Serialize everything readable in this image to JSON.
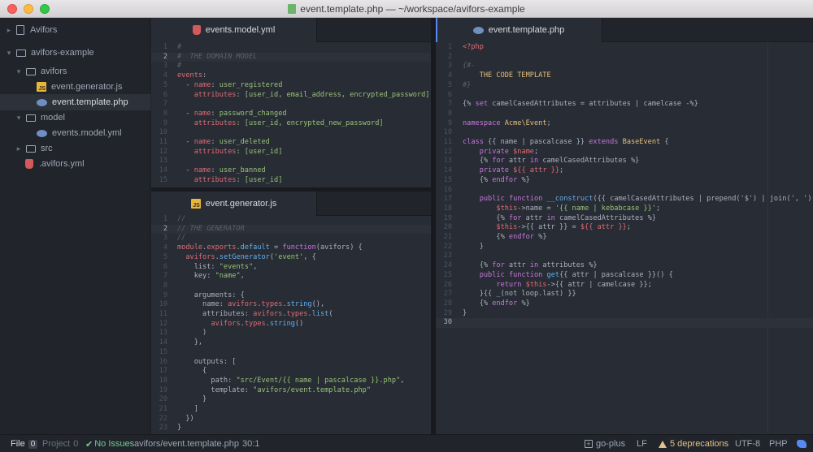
{
  "window": {
    "title": "event.template.php — ~/workspace/avifors-example"
  },
  "tree": {
    "root_project": "Avifors",
    "items": [
      {
        "label": "avifors-example",
        "icon": "folder-icon"
      },
      {
        "label": "avifors",
        "icon": "folder-icon"
      },
      {
        "label": "event.generator.js",
        "icon": "js-file-icon"
      },
      {
        "label": "event.template.php",
        "icon": "php-file-icon"
      },
      {
        "label": "model",
        "icon": "folder-icon"
      },
      {
        "label": "events.model.yml",
        "icon": "php-file-icon"
      },
      {
        "label": "src",
        "icon": "folder-icon"
      },
      {
        "label": ".avifors.yml",
        "icon": "yml-file-icon"
      }
    ]
  },
  "panes": {
    "yml": {
      "tab": "events.model.yml",
      "lines": [
        {
          "n": "1",
          "t": [
            [
              "#",
              "com"
            ]
          ]
        },
        {
          "n": "2",
          "t": [
            [
              "#  THE DOMAIN MODEL",
              "com"
            ]
          ],
          "cursor": true
        },
        {
          "n": "3",
          "t": [
            [
              "#",
              "com"
            ]
          ]
        },
        {
          "n": "4",
          "t": [
            [
              "events",
              "key"
            ],
            [
              ":",
              ""
            ]
          ]
        },
        {
          "n": "5",
          "t": [
            [
              "  - ",
              ""
            ],
            [
              "name",
              "key"
            ],
            [
              ": ",
              ""
            ],
            [
              "user_registered",
              "str"
            ]
          ]
        },
        {
          "n": "6",
          "t": [
            [
              "    ",
              ""
            ],
            [
              "attributes",
              "key"
            ],
            [
              ": [user_id, email_address, encrypted_password]",
              "str"
            ]
          ]
        },
        {
          "n": "7",
          "t": []
        },
        {
          "n": "8",
          "t": [
            [
              "  - ",
              ""
            ],
            [
              "name",
              "key"
            ],
            [
              ": ",
              ""
            ],
            [
              "password_changed",
              "str"
            ]
          ]
        },
        {
          "n": "9",
          "t": [
            [
              "    ",
              ""
            ],
            [
              "attributes",
              "key"
            ],
            [
              ": [user_id, encrypted_new_password]",
              "str"
            ]
          ]
        },
        {
          "n": "10",
          "t": []
        },
        {
          "n": "11",
          "t": [
            [
              "  - ",
              ""
            ],
            [
              "name",
              "key"
            ],
            [
              ": ",
              ""
            ],
            [
              "user_deleted",
              "str"
            ]
          ]
        },
        {
          "n": "12",
          "t": [
            [
              "    ",
              ""
            ],
            [
              "attributes",
              "key"
            ],
            [
              ": [user_id]",
              "str"
            ]
          ]
        },
        {
          "n": "13",
          "t": []
        },
        {
          "n": "14",
          "t": [
            [
              "  - ",
              ""
            ],
            [
              "name",
              "key"
            ],
            [
              ": ",
              ""
            ],
            [
              "user_banned",
              "str"
            ]
          ]
        },
        {
          "n": "15",
          "t": [
            [
              "    ",
              ""
            ],
            [
              "attributes",
              "key"
            ],
            [
              ": [user_id]",
              "str"
            ]
          ]
        }
      ]
    },
    "js": {
      "tab": "event.generator.js",
      "lines": [
        {
          "n": "1",
          "t": [
            [
              "//",
              "com"
            ]
          ]
        },
        {
          "n": "2",
          "t": [
            [
              "// THE GENERATOR",
              "com"
            ]
          ],
          "cursor": true
        },
        {
          "n": "3",
          "t": [
            [
              "//",
              "com"
            ]
          ]
        },
        {
          "n": "4",
          "t": [
            [
              "module",
              "key"
            ],
            [
              ".",
              ""
            ],
            [
              "exports",
              "key"
            ],
            [
              ".",
              ""
            ],
            [
              "default",
              "fn"
            ],
            [
              " = ",
              ""
            ],
            [
              "function",
              "kw"
            ],
            [
              "(avifors) {",
              ""
            ]
          ]
        },
        {
          "n": "5",
          "t": [
            [
              "  ",
              ""
            ],
            [
              "avifors",
              "key"
            ],
            [
              ".",
              ""
            ],
            [
              "setGenerator",
              "fn"
            ],
            [
              "(",
              ""
            ],
            [
              "'event'",
              "str"
            ],
            [
              ", {",
              ""
            ]
          ]
        },
        {
          "n": "6",
          "t": [
            [
              "    list: ",
              ""
            ],
            [
              "\"events\"",
              "str"
            ],
            [
              ",",
              ""
            ]
          ]
        },
        {
          "n": "7",
          "t": [
            [
              "    key: ",
              ""
            ],
            [
              "\"name\"",
              "str"
            ],
            [
              ",",
              ""
            ]
          ]
        },
        {
          "n": "8",
          "t": []
        },
        {
          "n": "9",
          "t": [
            [
              "    arguments: {",
              ""
            ]
          ]
        },
        {
          "n": "10",
          "t": [
            [
              "      name: ",
              ""
            ],
            [
              "avifors",
              "key"
            ],
            [
              ".",
              ""
            ],
            [
              "types",
              "key"
            ],
            [
              ".",
              ""
            ],
            [
              "string",
              "fn"
            ],
            [
              "(),",
              ""
            ]
          ]
        },
        {
          "n": "11",
          "t": [
            [
              "      attributes: ",
              ""
            ],
            [
              "avifors",
              "key"
            ],
            [
              ".",
              ""
            ],
            [
              "types",
              "key"
            ],
            [
              ".",
              ""
            ],
            [
              "list",
              "fn"
            ],
            [
              "(",
              ""
            ]
          ]
        },
        {
          "n": "12",
          "t": [
            [
              "        ",
              ""
            ],
            [
              "avifors",
              "key"
            ],
            [
              ".",
              ""
            ],
            [
              "types",
              "key"
            ],
            [
              ".",
              ""
            ],
            [
              "string",
              "fn"
            ],
            [
              "()",
              ""
            ]
          ]
        },
        {
          "n": "13",
          "t": [
            [
              "      )",
              ""
            ]
          ]
        },
        {
          "n": "14",
          "t": [
            [
              "    },",
              ""
            ]
          ]
        },
        {
          "n": "15",
          "t": []
        },
        {
          "n": "16",
          "t": [
            [
              "    outputs: [",
              ""
            ]
          ]
        },
        {
          "n": "17",
          "t": [
            [
              "      {",
              ""
            ]
          ]
        },
        {
          "n": "18",
          "t": [
            [
              "        path: ",
              ""
            ],
            [
              "\"src/Event/{{ name | pascalcase }}.php\"",
              "str"
            ],
            [
              ",",
              ""
            ]
          ]
        },
        {
          "n": "19",
          "t": [
            [
              "        template: ",
              ""
            ],
            [
              "\"avifors/event.template.php\"",
              "str"
            ]
          ]
        },
        {
          "n": "20",
          "t": [
            [
              "      }",
              ""
            ]
          ]
        },
        {
          "n": "21",
          "t": [
            [
              "    ]",
              ""
            ]
          ]
        },
        {
          "n": "22",
          "t": [
            [
              "  })",
              ""
            ]
          ]
        },
        {
          "n": "23",
          "t": [
            [
              "}",
              ""
            ]
          ]
        }
      ]
    },
    "php": {
      "tab": "event.template.php",
      "lines": [
        {
          "n": "1",
          "t": [
            [
              "<?php",
              "key"
            ]
          ]
        },
        {
          "n": "2",
          "t": []
        },
        {
          "n": "3",
          "t": [
            [
              "{#-",
              "com"
            ]
          ]
        },
        {
          "n": "4",
          "t": [
            [
              "    THE CODE TEMPLATE",
              "tag"
            ]
          ]
        },
        {
          "n": "5",
          "t": [
            [
              "#}",
              "com"
            ]
          ]
        },
        {
          "n": "6",
          "t": []
        },
        {
          "n": "7",
          "t": [
            [
              "{% ",
              ""
            ],
            [
              "set",
              "kw"
            ],
            [
              " camelCasedAttributes = attributes | camelcase -%}",
              ""
            ]
          ]
        },
        {
          "n": "8",
          "t": []
        },
        {
          "n": "9",
          "t": [
            [
              "namespace",
              "kw"
            ],
            [
              " ",
              ""
            ],
            [
              "Acme\\Event",
              "tag"
            ],
            [
              ";",
              ""
            ]
          ]
        },
        {
          "n": "10",
          "t": []
        },
        {
          "n": "11",
          "t": [
            [
              "class",
              "kw"
            ],
            [
              " {{ name | pascalcase }} ",
              ""
            ],
            [
              "extends",
              "kw"
            ],
            [
              " ",
              ""
            ],
            [
              "BaseEvent",
              "tag"
            ],
            [
              " {",
              ""
            ]
          ]
        },
        {
          "n": "12",
          "t": [
            [
              "    ",
              ""
            ],
            [
              "private",
              "kw"
            ],
            [
              " ",
              ""
            ],
            [
              "$name",
              "key"
            ],
            [
              ";",
              ""
            ]
          ]
        },
        {
          "n": "13",
          "t": [
            [
              "    {% ",
              ""
            ],
            [
              "for",
              "kw"
            ],
            [
              " attr ",
              ""
            ],
            [
              "in",
              "kw"
            ],
            [
              " camelCasedAttributes %}",
              ""
            ]
          ]
        },
        {
          "n": "14",
          "t": [
            [
              "    ",
              ""
            ],
            [
              "private",
              "kw"
            ],
            [
              " ",
              ""
            ],
            [
              "${{ attr }}",
              "key"
            ],
            [
              ";",
              ""
            ]
          ]
        },
        {
          "n": "15",
          "t": [
            [
              "    {% ",
              ""
            ],
            [
              "endfor",
              "kw"
            ],
            [
              " %}",
              ""
            ]
          ]
        },
        {
          "n": "16",
          "t": []
        },
        {
          "n": "17",
          "t": [
            [
              "    ",
              ""
            ],
            [
              "public",
              "kw"
            ],
            [
              " ",
              ""
            ],
            [
              "function",
              "kw"
            ],
            [
              " ",
              ""
            ],
            [
              "__construct",
              "fn"
            ],
            [
              "({{ camelCasedAttributes | prepend('$') | join(', ') }}) {",
              ""
            ]
          ]
        },
        {
          "n": "18",
          "t": [
            [
              "        ",
              ""
            ],
            [
              "$this",
              "key"
            ],
            [
              "->name = ",
              ""
            ],
            [
              "'{{ name | kebabcase }}'",
              "str"
            ],
            [
              ";",
              ""
            ]
          ]
        },
        {
          "n": "19",
          "t": [
            [
              "        {% ",
              ""
            ],
            [
              "for",
              "kw"
            ],
            [
              " attr ",
              ""
            ],
            [
              "in",
              "kw"
            ],
            [
              " camelCasedAttributes %}",
              ""
            ]
          ]
        },
        {
          "n": "20",
          "t": [
            [
              "        ",
              ""
            ],
            [
              "$this",
              "key"
            ],
            [
              "->{{ attr }} = ",
              ""
            ],
            [
              "${{ attr }}",
              "key"
            ],
            [
              ";",
              ""
            ]
          ]
        },
        {
          "n": "21",
          "t": [
            [
              "        {% ",
              ""
            ],
            [
              "endfor",
              "kw"
            ],
            [
              " %}",
              ""
            ]
          ]
        },
        {
          "n": "22",
          "t": [
            [
              "    }",
              ""
            ]
          ]
        },
        {
          "n": "23",
          "t": []
        },
        {
          "n": "24",
          "t": [
            [
              "    {% ",
              ""
            ],
            [
              "for",
              "kw"
            ],
            [
              " attr ",
              ""
            ],
            [
              "in",
              "kw"
            ],
            [
              " attributes %}",
              ""
            ]
          ]
        },
        {
          "n": "25",
          "t": [
            [
              "    ",
              ""
            ],
            [
              "public",
              "kw"
            ],
            [
              " ",
              ""
            ],
            [
              "function",
              "kw"
            ],
            [
              " ",
              ""
            ],
            [
              "get",
              "fn"
            ],
            [
              "{{ attr | pascalcase }}() {",
              ""
            ]
          ]
        },
        {
          "n": "26",
          "t": [
            [
              "        ",
              ""
            ],
            [
              "return",
              "kw"
            ],
            [
              " ",
              ""
            ],
            [
              "$this",
              "key"
            ],
            [
              "->{{ attr | camelcase }};",
              ""
            ]
          ]
        },
        {
          "n": "27",
          "t": [
            [
              "    }{{ _(not loop.last) }}",
              ""
            ]
          ]
        },
        {
          "n": "28",
          "t": [
            [
              "    {% ",
              ""
            ],
            [
              "endfor",
              "kw"
            ],
            [
              " %}",
              ""
            ]
          ]
        },
        {
          "n": "29",
          "t": [
            [
              "}",
              ""
            ]
          ]
        },
        {
          "n": "30",
          "t": [],
          "cursor": true
        }
      ]
    }
  },
  "status": {
    "file_label": "File",
    "file_count": "0",
    "project_label": "Project",
    "project_count": "0",
    "issues": "No Issues",
    "path": "avifors/event.template.php",
    "cursor": "30:1",
    "git": "go-plus",
    "line_ending": "LF",
    "deprecations": "5 deprecations",
    "encoding": "UTF-8",
    "grammar": "PHP",
    "colors": {
      "ok": "#73c990",
      "warning": "#e2c08d",
      "accent": "#568af2"
    }
  }
}
